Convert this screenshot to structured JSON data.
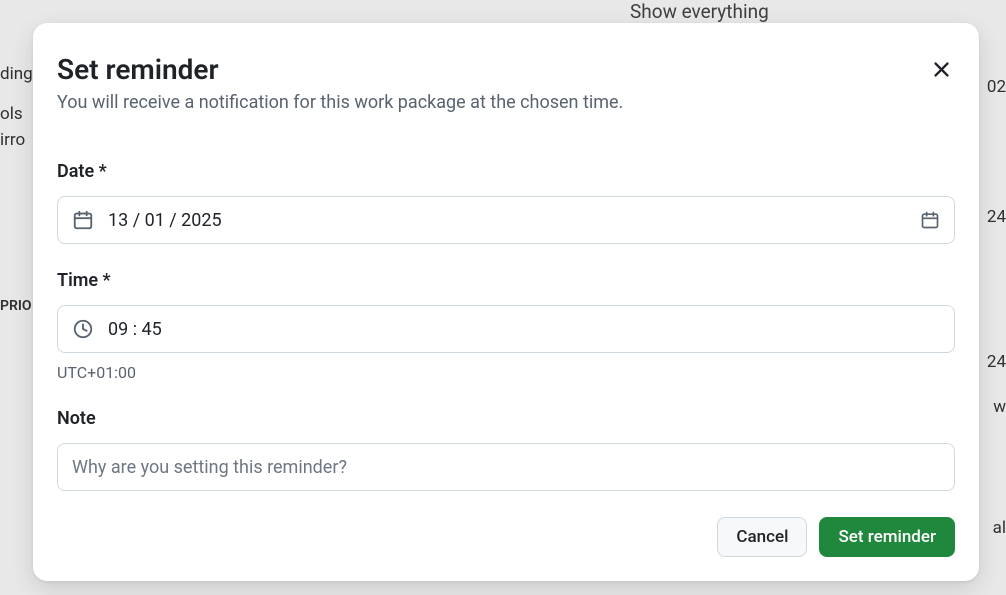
{
  "background": {
    "text_top_right": "Show everything",
    "text_left_1": "ding",
    "text_left_2": "ols",
    "text_left_3": "irro",
    "text_left_4": "PRIO",
    "text_right_1": "02",
    "text_right_2": "24",
    "text_right_3": "24",
    "text_right_4": "w",
    "text_right_5": "al"
  },
  "modal": {
    "title": "Set reminder",
    "subtitle": "You will receive a notification for this work package at the chosen time.",
    "date": {
      "label": "Date *",
      "value": "13 / 01 / 2025"
    },
    "time": {
      "label": "Time *",
      "value": "09 : 45",
      "timezone": "UTC+01:00"
    },
    "note": {
      "label": "Note",
      "placeholder": "Why are you setting this reminder?"
    },
    "buttons": {
      "cancel": "Cancel",
      "submit": "Set reminder"
    }
  }
}
